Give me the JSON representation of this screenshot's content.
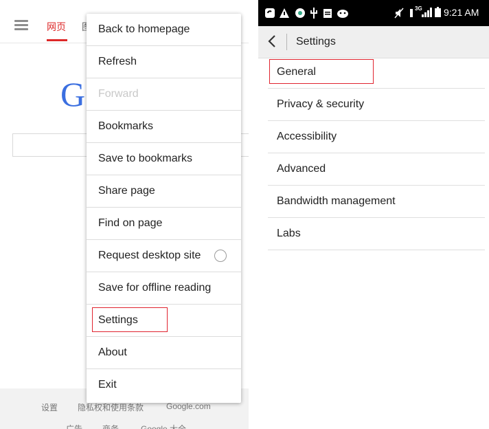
{
  "left": {
    "tabs": [
      "网页",
      "图"
    ],
    "logo_letter": "G",
    "footer_row1": [
      "设置",
      "隐私权和使用条款",
      "Google.com"
    ],
    "footer_row2": [
      "广告",
      "商务",
      "Google 大全"
    ]
  },
  "menu": {
    "items": [
      {
        "label": "Back to homepage"
      },
      {
        "label": "Refresh"
      },
      {
        "label": "Forward"
      },
      {
        "label": "Bookmarks"
      },
      {
        "label": "Save to bookmarks"
      },
      {
        "label": "Share page"
      },
      {
        "label": "Find on page"
      },
      {
        "label": "Request desktop site"
      },
      {
        "label": "Save for offline reading"
      },
      {
        "label": "Settings"
      },
      {
        "label": "About"
      },
      {
        "label": "Exit"
      }
    ],
    "disabled_item": "Forward",
    "toggle_checked": false,
    "highlighted_item": "Settings"
  },
  "right": {
    "status_bar": {
      "left_icons": [
        "sync-icon",
        "warning-icon",
        "app-icon",
        "usb-icon",
        "clipboard-icon",
        "android-icon"
      ],
      "network": "3G",
      "time": "9:21 AM"
    },
    "title": "Settings",
    "items": [
      {
        "label": "General"
      },
      {
        "label": "Privacy & security"
      },
      {
        "label": "Accessibility"
      },
      {
        "label": "Advanced"
      },
      {
        "label": "Bandwidth management"
      },
      {
        "label": "Labs"
      }
    ],
    "highlighted_item": "General"
  },
  "colors": {
    "highlight": "#e0232e",
    "tab_active": "#dd2828",
    "status_bar_bg": "#000000",
    "app_bar_bg": "#efefef"
  }
}
